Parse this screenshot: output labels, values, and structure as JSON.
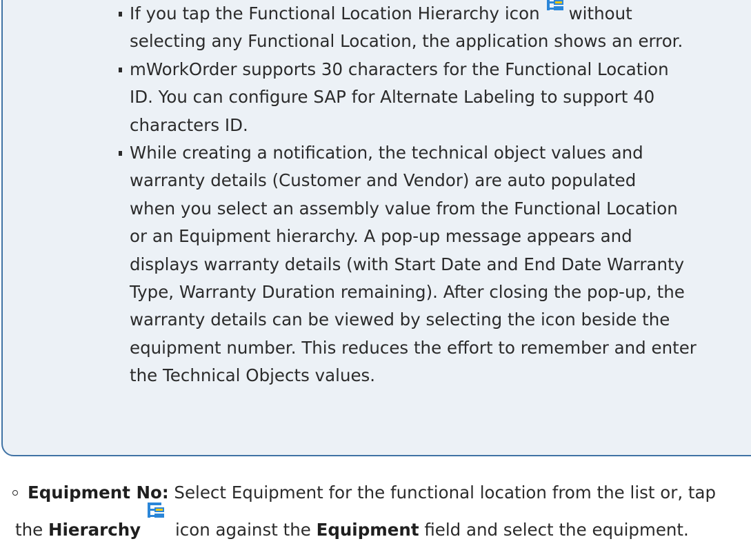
{
  "note": {
    "items": [
      {
        "lines": [
          {
            "before": "If you tap the Functional Location Hierarchy icon",
            "icon": "hierarchy-icon",
            "after": "without"
          },
          {
            "text": "selecting any Functional Location, the application shows an error."
          }
        ]
      },
      {
        "lines": [
          {
            "text": "mWorkOrder supports 30 characters for the Functional Location"
          },
          {
            "text": "ID. You can configure SAP for Alternate Labeling to support 40"
          },
          {
            "text": "characters ID."
          }
        ]
      },
      {
        "lines": [
          {
            "text": "While creating a notification, the technical object values and"
          },
          {
            "text": "warranty details (Customer and Vendor) are auto populated"
          },
          {
            "text": "when you select an assembly value from the Functional Location"
          },
          {
            "text": "or an Equipment hierarchy. A pop-up message appears and"
          },
          {
            "text": "displays warranty details (with Start Date and End Date Warranty"
          },
          {
            "text": "Type, Warranty Duration remaining). After closing the pop-up, the"
          },
          {
            "text": "warranty details can be viewed by selecting the icon beside the"
          },
          {
            "text": "equipment number. This reduces the effort to remember and enter"
          },
          {
            "text": "the Technical Objects values."
          }
        ]
      }
    ]
  },
  "equipment": {
    "label": "Equipment No:",
    "text1": " Select Equipment for the functional location from the list or, tap",
    "text2a": "the ",
    "hierarchy_bold": "Hierarchy",
    "icon": "hierarchy-icon",
    "text2b": " icon against the ",
    "equipment_bold": "Equipment",
    "text2c": " field and select the equipment."
  },
  "colors": {
    "note_background": "#ecf1f6",
    "note_border": "#3f72a4",
    "icon_blue": "#2b86d8",
    "icon_yellow": "#f2c811"
  }
}
